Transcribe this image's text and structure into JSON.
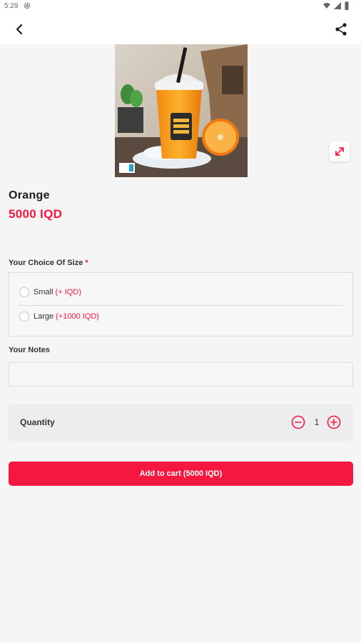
{
  "status_bar": {
    "time": "5:29"
  },
  "product": {
    "name": "Orange",
    "price": "5000 IQD"
  },
  "size_section": {
    "label": "Your Choice Of Size",
    "required_mark": "*",
    "options": [
      {
        "label": "Small",
        "extra": "(+ IQD)"
      },
      {
        "label": "Large",
        "extra": "(+1000 IQD)"
      }
    ]
  },
  "notes_section": {
    "label": "Your Notes",
    "value": "",
    "placeholder": ""
  },
  "quantity": {
    "label": "Quantity",
    "value": "1"
  },
  "cart_button": {
    "label": "Add to cart (5000 IQD)"
  },
  "colors": {
    "accent": "#f5173f",
    "background": "#f5f5f6"
  },
  "icons": {
    "back": "back-arrow-icon",
    "share": "share-icon",
    "expand": "expand-icon",
    "minus": "minus-circle-icon",
    "plus": "plus-circle-icon"
  }
}
